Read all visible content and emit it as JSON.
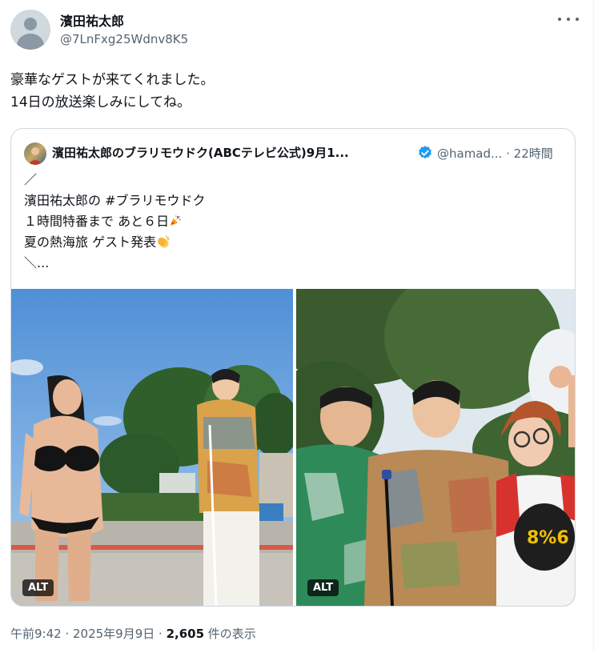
{
  "author": {
    "name": "濱田祐太郎",
    "handle": "@7LnFxg25Wdnv8K5"
  },
  "tweet": {
    "text": "豪華なゲストが来てくれました。\n14日の放送楽しみにしてね。"
  },
  "quoted": {
    "name": "濱田祐太郎のブラリモウドク(ABCテレビ公式)9月1...",
    "handle": "@hamad...",
    "separator": "·",
    "time": "22時間",
    "line1": "／",
    "line2": "濱田祐太郎の #ブラリモウドク",
    "line3": "１時間特番まで あと６日",
    "line4": "夏の熱海旅 ゲスト発表",
    "line5": "＼...",
    "emoji_line3": "party-popper-icon",
    "emoji_line4": "clapping-hands-icon",
    "photos": [
      {
        "alt_badge": "ALT",
        "description_icon": "photo-beach-guests"
      },
      {
        "alt_badge": "ALT",
        "description_icon": "photo-group-guests"
      }
    ]
  },
  "footer": {
    "time": "午前9:42",
    "sep1": " · ",
    "date": "2025年9月9日",
    "sep2": " · ",
    "views": "2,605",
    "views_label": " 件の表示"
  },
  "colors": {
    "verified": "#1d9bf0",
    "secondary_text": "#536471",
    "border": "#cfd9de"
  }
}
